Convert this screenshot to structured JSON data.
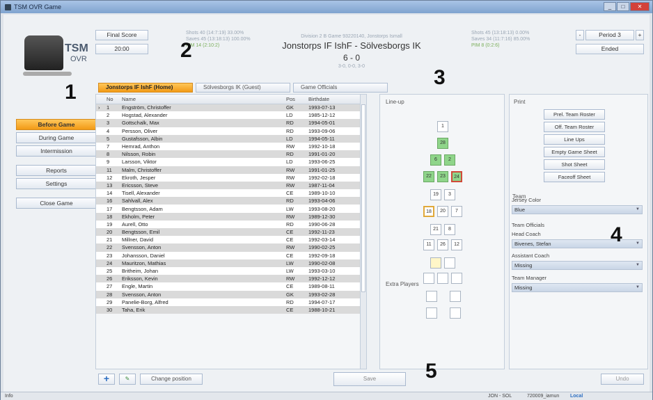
{
  "window": {
    "title": "TSM OVR Game"
  },
  "logo": {
    "line1": "TSM",
    "line2": "OVR"
  },
  "sidebar": {
    "items": [
      {
        "label": "Before Game",
        "active": true
      },
      {
        "label": "During Game"
      },
      {
        "label": "Intermission"
      },
      {
        "label": "Reports"
      },
      {
        "label": "Settings"
      },
      {
        "label": "Close Game"
      }
    ]
  },
  "header": {
    "final_score_btn": "Final Score",
    "time": "20:00",
    "home_stats": [
      "Shots 40 (14:7:19) 33.00%",
      "Saves 45 (13:18:13) 100.00%",
      "PIM 14 (2:10:2)"
    ],
    "division": "Division 2 B  Game 93220140, Jonstorps Ismall",
    "match": "Jonstorps IF IshF - Sölvesborgs IK",
    "score": "6 - 0",
    "periods": "3-0, 0-0, 3-0",
    "away_stats": [
      "Shots 45 (13:18:13) 0.00%",
      "Saves 34 (11:7:16) 85.00%",
      "PIM 8 (0:2:6)"
    ],
    "period_label": "Period 3",
    "period_minus": "-",
    "period_plus": "+",
    "status": "Ended"
  },
  "tabs": [
    {
      "label": "Jonstorps IF IshF (Home)",
      "active": true
    },
    {
      "label": "Sölvesborgs IK (Guest)"
    },
    {
      "label": "Game Officials"
    }
  ],
  "roster": {
    "columns": [
      "No",
      "Name",
      "Pos",
      "Birthdate"
    ],
    "rows": [
      [
        "1",
        "Engström, Christoffer",
        "GK",
        "1993-07-13"
      ],
      [
        "2",
        "Hogstad, Alexander",
        "LD",
        "1985-12-12"
      ],
      [
        "3",
        "Gottschalk, Max",
        "RD",
        "1994-05-01"
      ],
      [
        "4",
        "Persson, Oliver",
        "RD",
        "1993-09-06"
      ],
      [
        "5",
        "Gustafsson, Albin",
        "LD",
        "1994-05-11"
      ],
      [
        "7",
        "Hemrad, Anthon",
        "RW",
        "1992-10-18"
      ],
      [
        "8",
        "Nilsson, Robin",
        "RD",
        "1991-01-20"
      ],
      [
        "9",
        "Larsson, Viktor",
        "LD",
        "1993-06-25"
      ],
      [
        "11",
        "Malm, Christoffer",
        "RW",
        "1991-01-25"
      ],
      [
        "12",
        "Ekroth, Jesper",
        "RW",
        "1992-02-18"
      ],
      [
        "13",
        "Ericsson, Steve",
        "RW",
        "1987-11-04"
      ],
      [
        "14",
        "Tisell, Alexander",
        "CE",
        "1989-10-10"
      ],
      [
        "16",
        "Sahlvall, Alex",
        "RD",
        "1993-04-06"
      ],
      [
        "17",
        "Bengtsson, Adam",
        "LW",
        "1993-08-20"
      ],
      [
        "18",
        "Ekholm, Peter",
        "RW",
        "1989-12-30"
      ],
      [
        "19",
        "Aurell, Otto",
        "RD",
        "1990-06-28"
      ],
      [
        "20",
        "Bengtsson, Emil",
        "CE",
        "1992-11-23"
      ],
      [
        "21",
        "Millner, David",
        "CE",
        "1992-03-14"
      ],
      [
        "22",
        "Svensson, Anton",
        "RW",
        "1990-02-25"
      ],
      [
        "23",
        "Johansson, Daniel",
        "CE",
        "1992-09-18"
      ],
      [
        "24",
        "Mauritzon, Mathias",
        "LW",
        "1990-02-08"
      ],
      [
        "25",
        "Britheim, Johan",
        "LW",
        "1993-03-10"
      ],
      [
        "26",
        "Eriksson, Kevin",
        "RW",
        "1992-12-12"
      ],
      [
        "27",
        "Engle, Martin",
        "CE",
        "1989-08-11"
      ],
      [
        "28",
        "Svensson, Anton",
        "GK",
        "1993-02-28"
      ],
      [
        "29",
        "Panelie-Borg, Alfred",
        "RD",
        "1994-07-17"
      ],
      [
        "30",
        "Taha, Erik",
        "CE",
        "1988-10-21"
      ]
    ]
  },
  "lineup": {
    "title": "Line-up",
    "goalie": [
      "1"
    ],
    "boxes_row1": [
      "28"
    ],
    "boxes_row2": [
      "6",
      "2"
    ],
    "boxes_row3": [
      "22",
      "23",
      "24"
    ],
    "boxes_row4": [
      "19",
      "3"
    ],
    "boxes_row5": [
      "18",
      "20",
      "7"
    ],
    "boxes_row6": [
      "21",
      "8"
    ],
    "boxes_row7": [
      "11",
      "26",
      "12"
    ],
    "extra_title": "Extra Players"
  },
  "print": {
    "title": "Print",
    "buttons": [
      "Prel. Team Roster",
      "Off. Team Roster",
      "Line Ups",
      "Empty Game Sheet",
      "Shot Sheet",
      "Faceoff Sheet"
    ]
  },
  "team": {
    "title": "Team",
    "jersey_label": "Jersey Color",
    "jersey_value": "Blue",
    "officials_title": "Team Officials",
    "head_coach_label": "Head Coach",
    "head_coach_value": "Bivenes, Stefan",
    "assistant_label": "Assistant Coach",
    "assistant_value": "Missing",
    "manager_label": "Team Manager",
    "manager_value": "Missing"
  },
  "bottom": {
    "change_position": "Change position",
    "save": "Save",
    "undo": "Undo"
  },
  "statusbar": {
    "left": "Info",
    "game": "JON - SOL",
    "user": "720009_iamun",
    "mode": "Local"
  },
  "markers": [
    "1",
    "2",
    "3",
    "4",
    "5"
  ]
}
